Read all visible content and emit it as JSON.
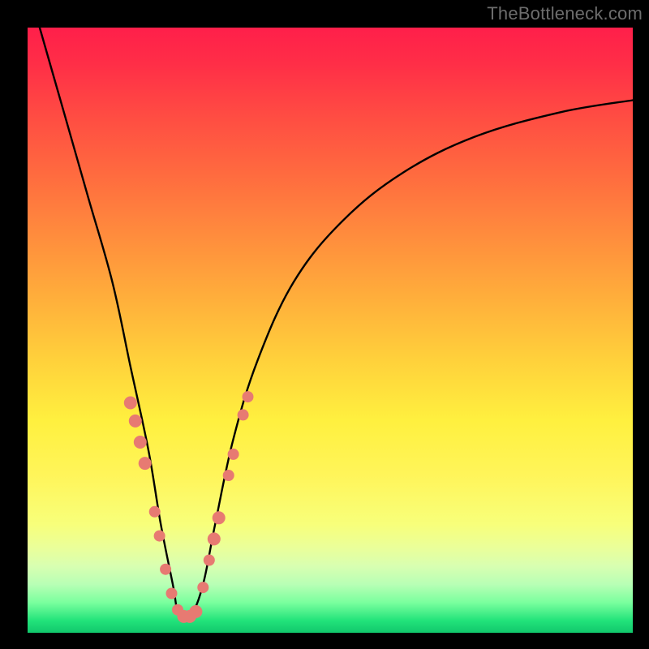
{
  "watermark": "TheBottleneck.com",
  "colors": {
    "marker": "#e77a72",
    "curve": "#000000",
    "frame": "#000000"
  },
  "chart_data": {
    "type": "line",
    "title": "",
    "xlabel": "",
    "ylabel": "",
    "xlim": [
      0,
      100
    ],
    "ylim": [
      0,
      100
    ],
    "grid": false,
    "legend": false,
    "note": "Axes are unlabeled in the image; x is a normalized horizontal position and y is a normalized value where 100=top and 0=bottom. Curve reaches a minimum near x≈25 at y≈2 and rises toward both edges.",
    "series": [
      {
        "name": "bottleneck-curve",
        "x": [
          2,
          6,
          10,
          14,
          17,
          20,
          22,
          24,
          25,
          27,
          29,
          31,
          34,
          38,
          44,
          52,
          62,
          74,
          88,
          100
        ],
        "y": [
          100,
          86,
          72,
          58,
          44,
          30,
          18,
          8,
          3,
          3,
          8,
          18,
          32,
          45,
          58,
          68,
          76,
          82,
          86,
          88
        ]
      }
    ],
    "markers": {
      "name": "highlighted-points",
      "note": "Salmon-colored beads clustered near the curve's minimum and lower flanks.",
      "points": [
        {
          "x": 17.0,
          "y": 38.0,
          "r": 8
        },
        {
          "x": 17.8,
          "y": 35.0,
          "r": 8
        },
        {
          "x": 18.6,
          "y": 31.5,
          "r": 8
        },
        {
          "x": 19.4,
          "y": 28.0,
          "r": 8
        },
        {
          "x": 21.0,
          "y": 20.0,
          "r": 7
        },
        {
          "x": 21.8,
          "y": 16.0,
          "r": 7
        },
        {
          "x": 22.8,
          "y": 10.5,
          "r": 7
        },
        {
          "x": 23.8,
          "y": 6.5,
          "r": 7
        },
        {
          "x": 24.8,
          "y": 3.8,
          "r": 7
        },
        {
          "x": 25.8,
          "y": 2.7,
          "r": 8
        },
        {
          "x": 26.8,
          "y": 2.7,
          "r": 8
        },
        {
          "x": 27.8,
          "y": 3.5,
          "r": 8
        },
        {
          "x": 29.0,
          "y": 7.5,
          "r": 7
        },
        {
          "x": 30.0,
          "y": 12.0,
          "r": 7
        },
        {
          "x": 30.8,
          "y": 15.5,
          "r": 8
        },
        {
          "x": 31.6,
          "y": 19.0,
          "r": 8
        },
        {
          "x": 33.2,
          "y": 26.0,
          "r": 7
        },
        {
          "x": 34.0,
          "y": 29.5,
          "r": 7
        },
        {
          "x": 35.6,
          "y": 36.0,
          "r": 7
        },
        {
          "x": 36.4,
          "y": 39.0,
          "r": 7
        }
      ]
    }
  }
}
